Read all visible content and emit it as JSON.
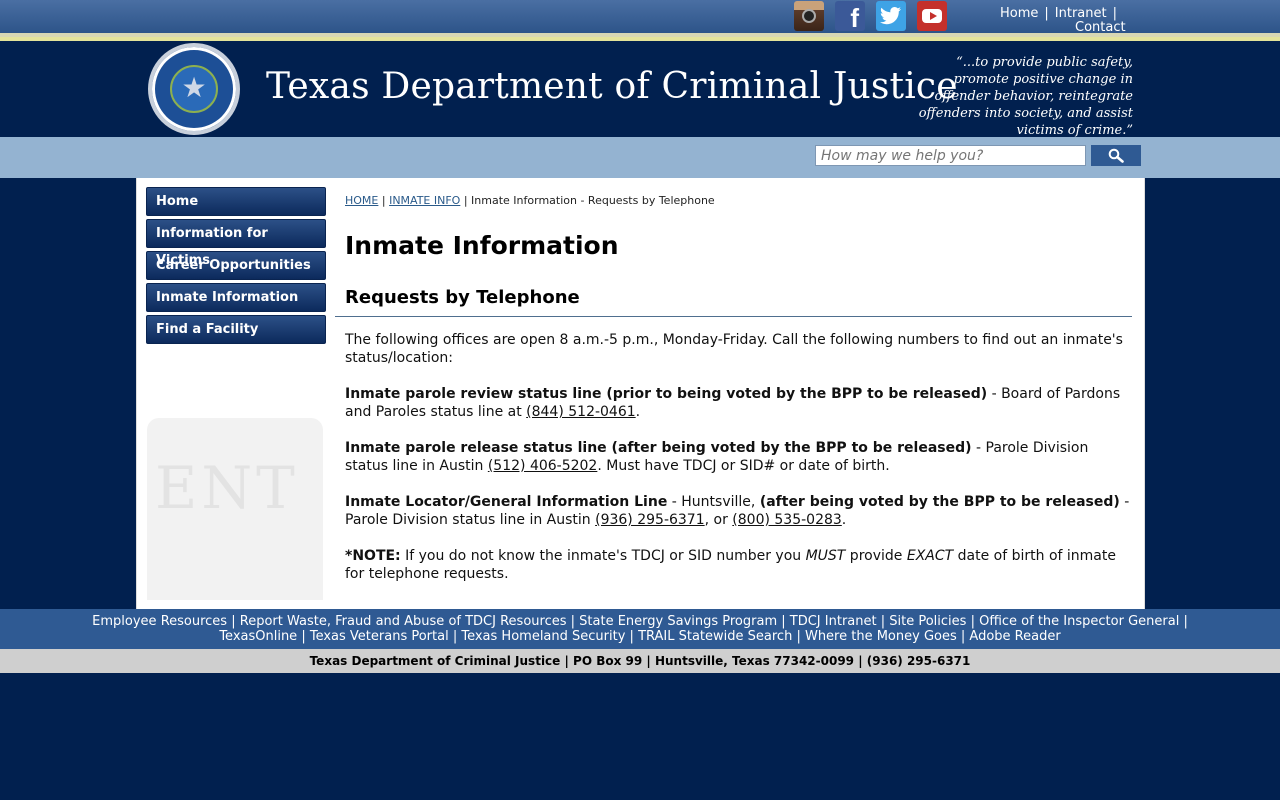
{
  "top_links": {
    "home": "Home",
    "intranet": "Intranet",
    "contact": "Contact",
    "sep": "|"
  },
  "social": {
    "facebook_glyph": "f",
    "icons": [
      "instagram-icon",
      "facebook-icon",
      "twitter-icon",
      "youtube-icon"
    ]
  },
  "header": {
    "title": "Texas Department of Criminal Justice",
    "motto": "“...to provide public safety, promote positive change in offender behavior, reintegrate offenders into society, and assist victims of crime.”",
    "seal_star": "★"
  },
  "search": {
    "placeholder": "How may we help you?"
  },
  "sidenav": {
    "items": [
      "Home",
      "Information for Victims",
      "Career Opportunities",
      "Inmate Information",
      "Find a Facility"
    ]
  },
  "breadcrumb": {
    "home": "HOME",
    "sep": " | ",
    "inmate_info": "INMATE INFO",
    "current": "Inmate Information - Requests by Telephone"
  },
  "content": {
    "title": "Inmate Information",
    "subtitle": "Requests by Telephone",
    "intro": "The following offices are open 8 a.m.-5 p.m., Monday-Friday. Call the following numbers to find out an inmate's status/location:",
    "p1_bold": "Inmate parole review status line (prior to being voted by the BPP to be released)",
    "p1_text": " - Board of Pardons and Paroles status line at ",
    "p1_phone": "(844) 512-0461",
    "p1_end": ".",
    "p2_bold": "Inmate parole release status line (after being voted by the BPP to be released)",
    "p2_text": " - Parole Division status line in Austin ",
    "p2_phone": "(512) 406-5202",
    "p2_end": ". Must have TDCJ or SID# or date of birth.",
    "p3_bold1": "Inmate Locator/General Information Line",
    "p3_text1": " - Huntsville, ",
    "p3_bold2": "(after being voted by the BPP to be released)",
    "p3_text2": " - Parole Division status line in Austin ",
    "p3_phone1": "(936) 295-6371",
    "p3_text3": ", or ",
    "p3_phone2": "(800) 535-0283",
    "p3_end": ".",
    "note_bold": "*NOTE:",
    "note_text1": " If you do not know the inmate's TDCJ or SID number you ",
    "note_must": "MUST",
    "note_text2": " provide ",
    "note_exact": "EXACT",
    "note_text3": " date of birth of inmate for telephone requests."
  },
  "watermark_text": "ENT",
  "footer": {
    "links": [
      "Employee Resources",
      "Report Waste, Fraud and Abuse of TDCJ Resources",
      "State Energy Savings Program",
      "TDCJ Intranet",
      "Site Policies",
      "Office of the Inspector General",
      "TexasOnline",
      "Texas Veterans Portal",
      "Texas Homeland Security",
      "TRAIL Statewide Search",
      "Where the Money Goes",
      "Adobe Reader"
    ],
    "address": "Texas Department of Criminal Justice | PO Box 99 | Huntsville, Texas 77342-0099 | (936) 295-6371"
  }
}
